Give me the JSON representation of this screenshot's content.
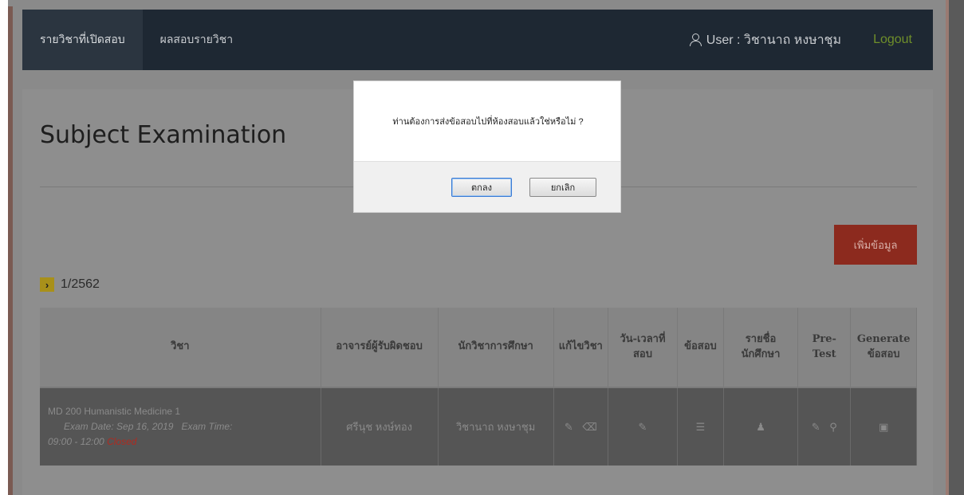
{
  "nav": {
    "items": [
      {
        "label": "รายวิชาที่เปิดสอบ"
      },
      {
        "label": "ผลสอบรายวิชา"
      }
    ],
    "user_text": "User : วิชานาถ หงษาชุม",
    "logout": "Logout"
  },
  "page": {
    "title": "Subject Examination",
    "add_button": "เพิ่มข้อมูล",
    "semester": "1/2562",
    "semester_icon": "chevron-right-icon"
  },
  "table": {
    "headers": [
      "วิชา",
      "อาจารย์ผู้รับผิดชอบ",
      "นักวิชาการศึกษา",
      "แก้ไขวิชา",
      "วัน-เวลาที่สอบ",
      "ข้อสอบ",
      "รายชื่อนักศึกษา",
      "Pre-Test",
      "Generate ข้อสอบ"
    ],
    "rows": [
      {
        "subject": "MD 200 Humanistic Medicine 1",
        "exam_date_label": "Exam Date:",
        "exam_date": "Sep 16, 2019",
        "exam_time_label": "Exam Time:",
        "exam_time": "09:00 - 12:00",
        "status": "Closed",
        "instructor": "ศรีนุช หงษ์ทอง",
        "academic": "วิชานาถ หงษาชุม"
      }
    ]
  },
  "dialog": {
    "message": "ท่านต้องการส่งข้อสอบไปที่ห้องสอบแล้วใช่หรือไม่ ?",
    "ok": "ตกลง",
    "cancel": "ยกเลิก"
  },
  "colors": {
    "navbar": "#1e2833",
    "overlay": "#8e8e8e",
    "add_button": "#8c2a1e",
    "logout": "#6f8f2a",
    "status_closed": "#b02a20"
  }
}
